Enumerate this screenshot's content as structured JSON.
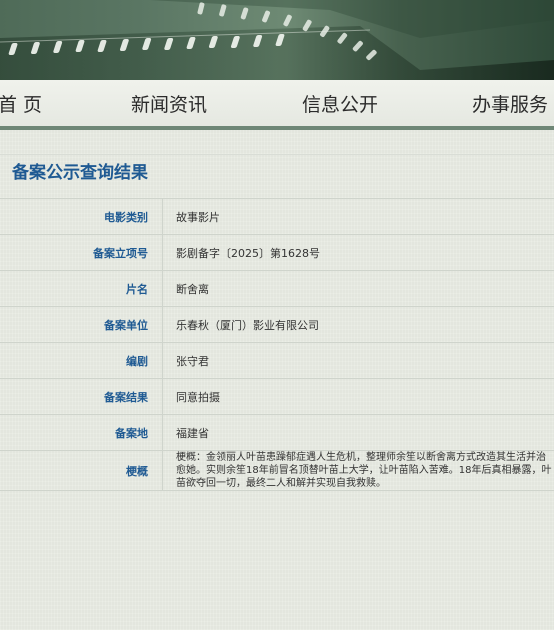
{
  "nav": {
    "items": [
      {
        "label": "首 页"
      },
      {
        "label": "新闻资讯"
      },
      {
        "label": "信息公开"
      },
      {
        "label": "办事服务"
      }
    ]
  },
  "page": {
    "title": "备案公示查询结果"
  },
  "record": {
    "rows": [
      {
        "label": "电影类别",
        "value": "故事影片"
      },
      {
        "label": "备案立项号",
        "value": "影剧备字〔2025〕第1628号"
      },
      {
        "label": "片名",
        "value": "断舍离"
      },
      {
        "label": "备案单位",
        "value": "乐春秋（厦门）影业有限公司"
      },
      {
        "label": "编剧",
        "value": "张守君"
      },
      {
        "label": "备案结果",
        "value": "同意拍摄"
      },
      {
        "label": "备案地",
        "value": "福建省"
      },
      {
        "label": "梗概",
        "value": "梗概：金领丽人叶苗患躁郁症遇人生危机，整理师余笙以断舍离方式改造其生活并治愈她。实则余笙18年前冒名顶替叶苗上大学，让叶苗陷入苦难。18年后真相暴露，叶苗欲夺回一切，最终二人和解并实现自我救赎。"
      }
    ]
  },
  "colors": {
    "banner_green": "#4f6b58",
    "nav_border": "#6e8676",
    "title_blue": "#1f5a93",
    "label_blue": "#1f5a93",
    "background": "#e9ece4"
  }
}
